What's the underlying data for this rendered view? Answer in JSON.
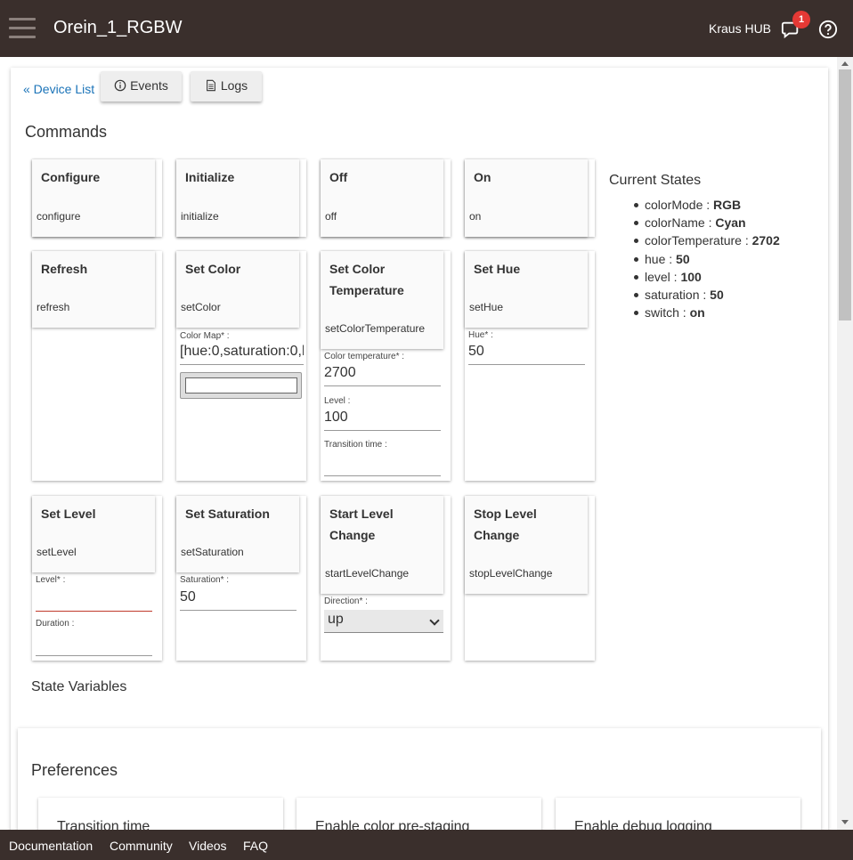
{
  "header": {
    "title": "Orein_1_RGBW",
    "hub_name": "Kraus HUB",
    "notification_count": "1"
  },
  "nav": {
    "device_list": "« Device List",
    "events": "Events",
    "logs": "Logs"
  },
  "commands_title": "Commands",
  "commands": {
    "configure": {
      "title": "Configure",
      "method": "configure"
    },
    "initialize": {
      "title": "Initialize",
      "method": "initialize"
    },
    "off": {
      "title": "Off",
      "method": "off"
    },
    "on": {
      "title": "On",
      "method": "on"
    },
    "refresh": {
      "title": "Refresh",
      "method": "refresh"
    },
    "set_color": {
      "title": "Set Color",
      "method": "setColor",
      "field_label": "Color Map* :",
      "field_value": "[hue:0,saturation:0,l"
    },
    "set_color_temperature": {
      "title": "Set Color Temperature",
      "method": "setColorTemperature",
      "field1_label": "Color temperature* :",
      "field1_value": "2700",
      "field2_label": "Level :",
      "field2_value": "100",
      "field3_label": "Transition time :",
      "field3_value": ""
    },
    "set_hue": {
      "title": "Set Hue",
      "method": "setHue",
      "field_label": "Hue* :",
      "field_value": "50"
    },
    "set_level": {
      "title": "Set Level",
      "method": "setLevel",
      "field1_label": "Level* :",
      "field1_value": "",
      "field2_label": "Duration :",
      "field2_value": ""
    },
    "set_saturation": {
      "title": "Set Saturation",
      "method": "setSaturation",
      "field_label": "Saturation* :",
      "field_value": "50"
    },
    "start_level_change": {
      "title": "Start Level Change",
      "method": "startLevelChange",
      "field_label": "Direction* :",
      "field_value": "up"
    },
    "stop_level_change": {
      "title": "Stop Level Change",
      "method": "stopLevelChange"
    }
  },
  "current_states": {
    "title": "Current States",
    "items": [
      {
        "key": "colorMode : ",
        "value": "RGB"
      },
      {
        "key": "colorName : ",
        "value": "Cyan"
      },
      {
        "key": "colorTemperature : ",
        "value": "2702"
      },
      {
        "key": "hue : ",
        "value": "50"
      },
      {
        "key": "level : ",
        "value": "100"
      },
      {
        "key": "saturation : ",
        "value": "50"
      },
      {
        "key": "switch : ",
        "value": "on"
      }
    ]
  },
  "state_variables_title": "State Variables",
  "preferences": {
    "title": "Preferences",
    "items": [
      "Transition time",
      "Enable color pre-staging",
      "Enable debug logging"
    ]
  },
  "footer": {
    "documentation": "Documentation",
    "community": "Community",
    "videos": "Videos",
    "faq": "FAQ"
  },
  "colors": {
    "header_bg": "#3a2f2c",
    "link": "#1a73b8",
    "badge": "#e53935"
  }
}
